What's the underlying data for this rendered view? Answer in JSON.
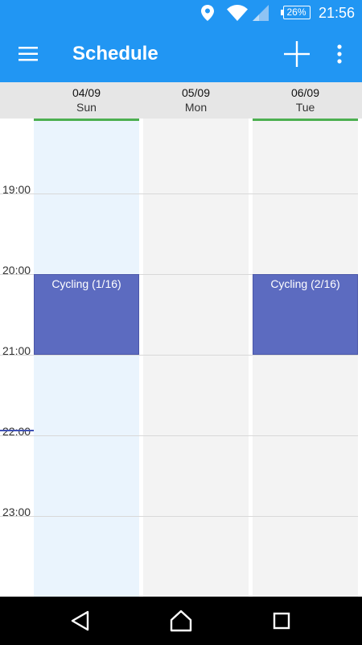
{
  "status_bar": {
    "battery": "26%",
    "time": "21:56",
    "icons": [
      "location-pin-icon",
      "wifi-icon",
      "signal-icon",
      "battery-icon"
    ]
  },
  "app_bar": {
    "title": "Schedule",
    "icons": [
      "hamburger-menu-icon",
      "add-icon",
      "more-vert-icon"
    ]
  },
  "days": [
    {
      "date": "04/09",
      "name": "Sun"
    },
    {
      "date": "05/09",
      "name": "Mon"
    },
    {
      "date": "06/09",
      "name": "Tue"
    }
  ],
  "time_labels": [
    "19:00",
    "20:00",
    "21:00",
    "22:00",
    "23:00"
  ],
  "events": [
    {
      "label": "Cycling (1/16)",
      "day": "04/09",
      "start": "20:00",
      "end": "21:00"
    },
    {
      "label": "Cycling (2/16)",
      "day": "06/09",
      "start": "20:00",
      "end": "21:00"
    }
  ],
  "nav_bar": {
    "icons": [
      "back-icon",
      "home-icon",
      "recents-icon"
    ]
  },
  "colors": {
    "primary": "#2196F3",
    "event": "#5c6bc0",
    "today_column": "#eaf4fd",
    "accent_line": "#4caf50"
  }
}
